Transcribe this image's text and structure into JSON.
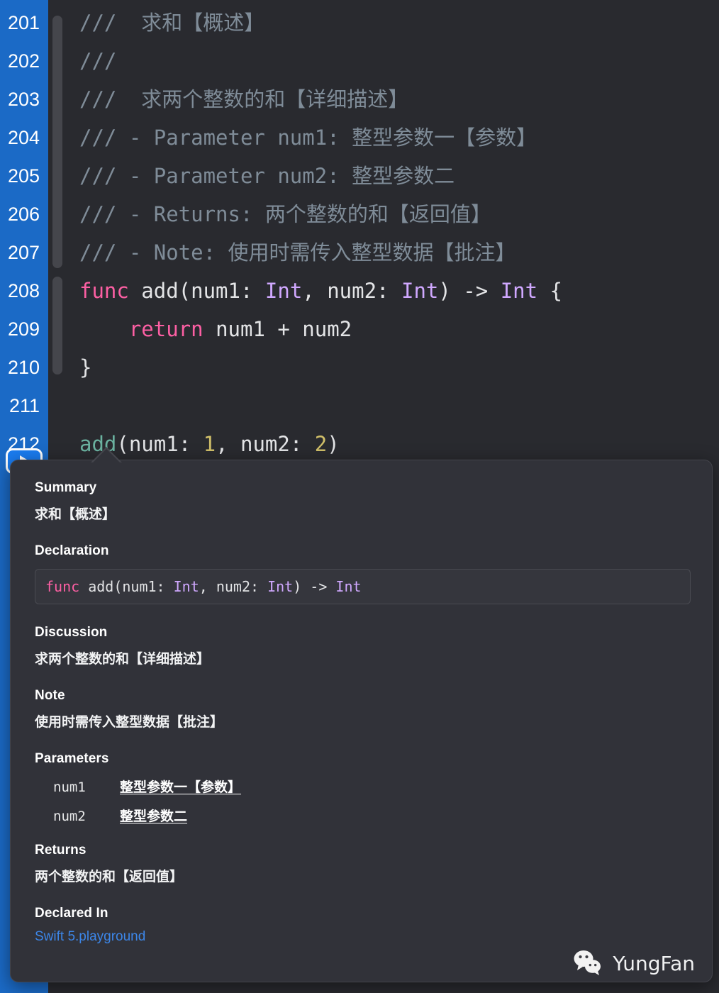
{
  "editor": {
    "theme_bg": "#292a2f",
    "gutter_bg": "#1b6ac6",
    "lines": [
      {
        "num": "201",
        "tokens": [
          {
            "t": "///  求和【概述】",
            "c": "comment"
          }
        ]
      },
      {
        "num": "202",
        "tokens": [
          {
            "t": "///",
            "c": "comment"
          }
        ]
      },
      {
        "num": "203",
        "tokens": [
          {
            "t": "///  求两个整数的和【详细描述】",
            "c": "comment"
          }
        ]
      },
      {
        "num": "204",
        "tokens": [
          {
            "t": "/// - Parameter num1: 整型参数一【参数】",
            "c": "comment"
          }
        ]
      },
      {
        "num": "205",
        "tokens": [
          {
            "t": "/// - Parameter num2: 整型参数二",
            "c": "comment"
          }
        ]
      },
      {
        "num": "206",
        "tokens": [
          {
            "t": "/// - Returns: 两个整数的和【返回值】",
            "c": "comment"
          }
        ]
      },
      {
        "num": "207",
        "tokens": [
          {
            "t": "/// - Note: 使用时需传入整型数据【批注】",
            "c": "comment"
          }
        ]
      },
      {
        "num": "208",
        "tokens": [
          {
            "t": "func",
            "c": "kw"
          },
          {
            "t": " add(num1: ",
            "c": "plain"
          },
          {
            "t": "Int",
            "c": "type"
          },
          {
            "t": ", num2: ",
            "c": "plain"
          },
          {
            "t": "Int",
            "c": "type"
          },
          {
            "t": ") -> ",
            "c": "plain"
          },
          {
            "t": "Int",
            "c": "type"
          },
          {
            "t": " {",
            "c": "plain"
          }
        ]
      },
      {
        "num": "209",
        "tokens": [
          {
            "t": "    ",
            "c": "plain"
          },
          {
            "t": "return",
            "c": "kw"
          },
          {
            "t": " num1 + num2",
            "c": "plain"
          }
        ]
      },
      {
        "num": "210",
        "tokens": [
          {
            "t": "}",
            "c": "plain"
          }
        ]
      },
      {
        "num": "211",
        "tokens": []
      },
      {
        "num": "212",
        "tokens": [
          {
            "t": "add",
            "c": "fn"
          },
          {
            "t": "(num1: ",
            "c": "plain"
          },
          {
            "t": "1",
            "c": "num"
          },
          {
            "t": ", num2: ",
            "c": "plain"
          },
          {
            "t": "2",
            "c": "num"
          },
          {
            "t": ")",
            "c": "plain"
          }
        ]
      }
    ],
    "run_button_label": "Run"
  },
  "quick_help": {
    "summary_title": "Summary",
    "summary_body": "求和【概述】",
    "declaration_title": "Declaration",
    "declaration_code": "func add(num1: Int, num2: Int) -> Int",
    "declaration_tokens": [
      {
        "t": "func",
        "c": "kw"
      },
      {
        "t": " add(num1: ",
        "c": "plain"
      },
      {
        "t": "Int",
        "c": "type"
      },
      {
        "t": ", num2: ",
        "c": "plain"
      },
      {
        "t": "Int",
        "c": "type"
      },
      {
        "t": ") -> ",
        "c": "plain"
      },
      {
        "t": "Int",
        "c": "type"
      }
    ],
    "discussion_title": "Discussion",
    "discussion_body": "求两个整数的和【详细描述】",
    "note_title": "Note",
    "note_body": "使用时需传入整型数据【批注】",
    "parameters_title": "Parameters",
    "parameters": [
      {
        "name": "num1",
        "desc": "整型参数一【参数】"
      },
      {
        "name": "num2",
        "desc": "整型参数二"
      }
    ],
    "returns_title": "Returns",
    "returns_body": "两个整数的和【返回值】",
    "declared_in_title": "Declared In",
    "declared_in_link": "Swift 5.playground",
    "link_color": "#3c86e8"
  },
  "watermark": {
    "text": "YungFan",
    "icon": "wechat-icon"
  }
}
